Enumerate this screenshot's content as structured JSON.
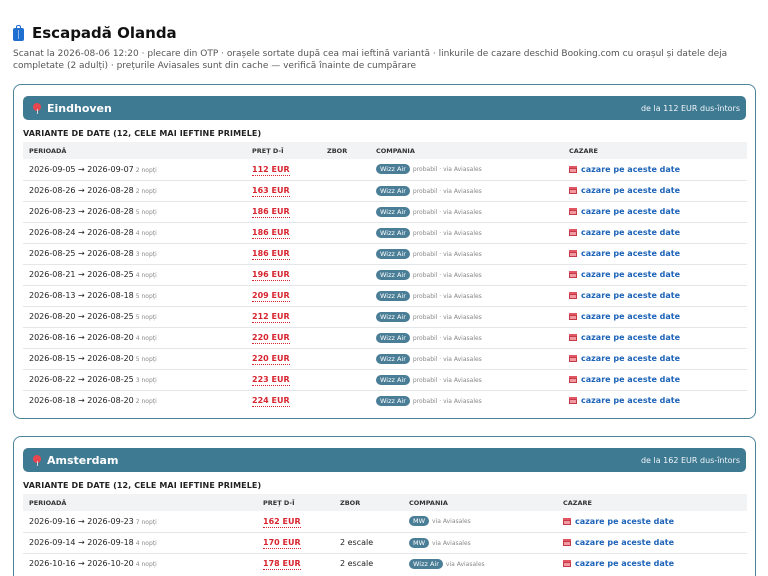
{
  "header": {
    "title": "Escapadă Olanda",
    "subtitle": "Scanat la 2026-08-06 12:20 · plecare din OTP · orașele sortate după cea mai ieftină variantă · linkurile de cazare deschid Booking.com cu orașul și datele deja completate (2 adulți) · prețurile Aviasales sunt din cache — verifică înainte de cumpărare"
  },
  "icons": {
    "title": "suitcase-icon",
    "city": "pin-icon",
    "hotel": "hotel-icon"
  },
  "colors": {
    "banner": "#3f7a93",
    "price": "#d8242f",
    "link": "#1d63b8",
    "badge": "#4a7e97"
  },
  "columns": {
    "period": "PERIOADĂ",
    "price": "PREȚ D-Î",
    "flight": "ZBOR",
    "airline": "COMPANIA",
    "hotel": "CAZARE"
  },
  "cities": [
    {
      "name": "Eindhoven",
      "from": "de la 112 EUR dus-întors",
      "section": "VARIANTE DE DATE (12, CELE MAI IEFTINE PRIMELE)",
      "rows": [
        {
          "period": "2026-09-05 → 2026-09-07",
          "nights": "2 nopți",
          "price": "112 EUR",
          "flight": "",
          "airline": "Wizz Air",
          "note": "probabil · via Aviasales",
          "hotel": "cazare pe aceste date"
        },
        {
          "period": "2026-08-26 → 2026-08-28",
          "nights": "2 nopți",
          "price": "163 EUR",
          "flight": "",
          "airline": "Wizz Air",
          "note": "probabil · via Aviasales",
          "hotel": "cazare pe aceste date"
        },
        {
          "period": "2026-08-23 → 2026-08-28",
          "nights": "5 nopți",
          "price": "186 EUR",
          "flight": "",
          "airline": "Wizz Air",
          "note": "probabil · via Aviasales",
          "hotel": "cazare pe aceste date"
        },
        {
          "period": "2026-08-24 → 2026-08-28",
          "nights": "4 nopți",
          "price": "186 EUR",
          "flight": "",
          "airline": "Wizz Air",
          "note": "probabil · via Aviasales",
          "hotel": "cazare pe aceste date"
        },
        {
          "period": "2026-08-25 → 2026-08-28",
          "nights": "3 nopți",
          "price": "186 EUR",
          "flight": "",
          "airline": "Wizz Air",
          "note": "probabil · via Aviasales",
          "hotel": "cazare pe aceste date"
        },
        {
          "period": "2026-08-21 → 2026-08-25",
          "nights": "4 nopți",
          "price": "196 EUR",
          "flight": "",
          "airline": "Wizz Air",
          "note": "probabil · via Aviasales",
          "hotel": "cazare pe aceste date"
        },
        {
          "period": "2026-08-13 → 2026-08-18",
          "nights": "5 nopți",
          "price": "209 EUR",
          "flight": "",
          "airline": "Wizz Air",
          "note": "probabil · via Aviasales",
          "hotel": "cazare pe aceste date"
        },
        {
          "period": "2026-08-20 → 2026-08-25",
          "nights": "5 nopți",
          "price": "212 EUR",
          "flight": "",
          "airline": "Wizz Air",
          "note": "probabil · via Aviasales",
          "hotel": "cazare pe aceste date"
        },
        {
          "period": "2026-08-16 → 2026-08-20",
          "nights": "4 nopți",
          "price": "220 EUR",
          "flight": "",
          "airline": "Wizz Air",
          "note": "probabil · via Aviasales",
          "hotel": "cazare pe aceste date"
        },
        {
          "period": "2026-08-15 → 2026-08-20",
          "nights": "5 nopți",
          "price": "220 EUR",
          "flight": "",
          "airline": "Wizz Air",
          "note": "probabil · via Aviasales",
          "hotel": "cazare pe aceste date"
        },
        {
          "period": "2026-08-22 → 2026-08-25",
          "nights": "3 nopți",
          "price": "223 EUR",
          "flight": "",
          "airline": "Wizz Air",
          "note": "probabil · via Aviasales",
          "hotel": "cazare pe aceste date"
        },
        {
          "period": "2026-08-18 → 2026-08-20",
          "nights": "2 nopți",
          "price": "224 EUR",
          "flight": "",
          "airline": "Wizz Air",
          "note": "probabil · via Aviasales",
          "hotel": "cazare pe aceste date"
        }
      ]
    },
    {
      "name": "Amsterdam",
      "from": "de la 162 EUR dus-întors",
      "section": "VARIANTE DE DATE (12, CELE MAI IEFTINE PRIMELE)",
      "rows": [
        {
          "period": "2026-09-16 → 2026-09-23",
          "nights": "7 nopți",
          "price": "162 EUR",
          "flight": "",
          "airline": "MW",
          "note": "via Aviasales",
          "hotel": "cazare pe aceste date"
        },
        {
          "period": "2026-09-14 → 2026-09-18",
          "nights": "4 nopți",
          "price": "170 EUR",
          "flight": "2 escale",
          "airline": "MW",
          "note": "via Aviasales",
          "hotel": "cazare pe aceste date"
        },
        {
          "period": "2026-10-16 → 2026-10-20",
          "nights": "4 nopți",
          "price": "178 EUR",
          "flight": "2 escale",
          "airline": "Wizz Air",
          "note": "via Aviasales",
          "hotel": "cazare pe aceste date"
        }
      ]
    }
  ]
}
